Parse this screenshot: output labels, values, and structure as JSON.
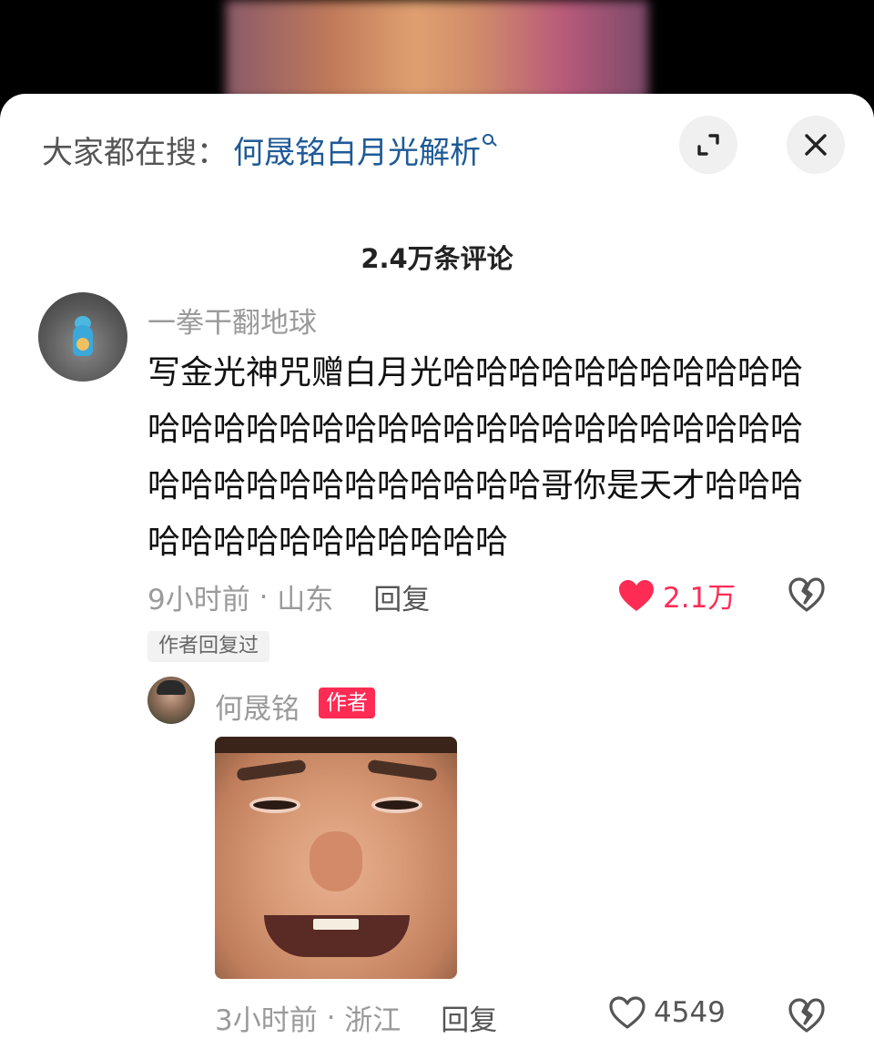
{
  "header": {
    "search_prefix": "大家都在搜：",
    "search_suggestion": "何晟铭白月光解析"
  },
  "comments_count_title": "2.4万条评论",
  "comment": {
    "username": "一拳干翻地球",
    "text": "写金光神咒赠白月光哈哈哈哈哈哈哈哈哈哈哈哈哈哈哈哈哈哈哈哈哈哈哈哈哈哈哈哈哈哈哈哈哈哈哈哈哈哈哈哈哈哈哈哥你是天才哈哈哈哈哈哈哈哈哈哈哈哈哈哈",
    "time": "9小时前",
    "location": "山东",
    "reply_label": "回复",
    "likes": "2.1万",
    "liked": true,
    "author_replied_tag": "作者回复过"
  },
  "reply": {
    "username": "何晟铭",
    "badge": "作者",
    "time": "3小时前",
    "location": "浙江",
    "reply_label": "回复",
    "likes": "4549",
    "liked": false
  },
  "colors": {
    "accent": "#fe2c55",
    "link": "#1e5a96"
  },
  "icons": {
    "expand": "expand-icon",
    "close": "close-icon",
    "like": "heart-icon",
    "dislike": "broken-heart-icon"
  }
}
